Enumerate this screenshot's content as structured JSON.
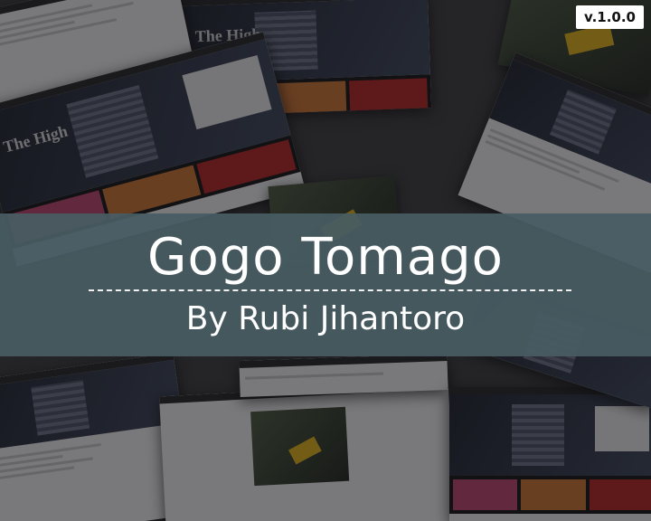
{
  "version": "v.1.0.0",
  "title": "Gogo Tomago",
  "subtitle": "By Rubi Jihantoro",
  "colors": {
    "banner": "#485c63",
    "text": "#ffffff",
    "background": "#3a3a3c"
  }
}
